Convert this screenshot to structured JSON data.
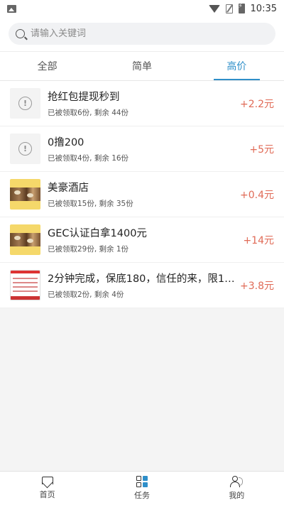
{
  "status_bar": {
    "time": "10:35"
  },
  "search": {
    "placeholder": "请输入关键词"
  },
  "tabs": [
    {
      "label": "全部",
      "active": false
    },
    {
      "label": "简单",
      "active": false
    },
    {
      "label": "高价",
      "active": true
    }
  ],
  "tasks": [
    {
      "title": "抢红包提现秒到",
      "meta": "已被领取6份, 剩余 44份",
      "reward": "+2.2元",
      "thumb": "alert-placeholder"
    },
    {
      "title": "0撸200",
      "meta": "已被领取4份, 剩余 16份",
      "reward": "+5元",
      "thumb": "alert-placeholder"
    },
    {
      "title": "美豪酒店",
      "meta": "已被领取15份, 剩余 35份",
      "reward": "+0.4元",
      "thumb": "food-image"
    },
    {
      "title": "GEC认证白拿1400元",
      "meta": "已被领取29份, 剩余 1份",
      "reward": "+14元",
      "thumb": "food-image"
    },
    {
      "title": "2分钟完成，保底180，信任的来，限10...",
      "meta": "已被领取2份, 剩余 4份",
      "reward": "+3.8元",
      "thumb": "screenshot-image"
    }
  ],
  "bottom_nav": [
    {
      "label": "首页",
      "icon": "home-icon"
    },
    {
      "label": "任务",
      "icon": "task-grid-icon",
      "active": true
    },
    {
      "label": "我的",
      "icon": "profile-icon"
    }
  ],
  "colors": {
    "accent": "#2f8fc9",
    "reward": "#e06a56"
  }
}
